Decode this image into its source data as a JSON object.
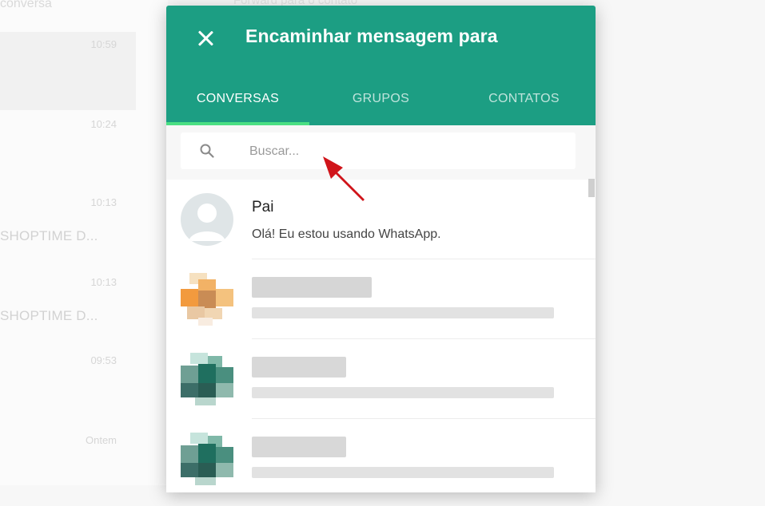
{
  "background": {
    "top_text": "conversa",
    "header_text": "Forward para o contato",
    "rows": [
      {
        "time": "10:59",
        "text": ""
      },
      {
        "time": "10:24",
        "text": ""
      },
      {
        "time": "10:13",
        "text": "SHOPTIME D..."
      },
      {
        "time": "10:13",
        "text": "SHOPTIME D..."
      },
      {
        "time": "09:53",
        "text": ""
      },
      {
        "time": "Ontem",
        "text": ""
      }
    ]
  },
  "modal": {
    "title": "Encaminhar mensagem para",
    "close_icon": "close-icon",
    "tabs": [
      {
        "label": "CONVERSAS",
        "active": true
      },
      {
        "label": "GRUPOS",
        "active": false
      },
      {
        "label": "CONTATOS",
        "active": false
      }
    ],
    "search": {
      "placeholder": "Buscar...",
      "value": ""
    },
    "contacts": [
      {
        "name": "Pai",
        "status": "Olá! Eu estou usando WhatsApp.",
        "blurred": false
      },
      {
        "name": "",
        "status": "",
        "blurred": true
      },
      {
        "name": "",
        "status": "",
        "blurred": true
      },
      {
        "name": "",
        "status": "",
        "blurred": true
      }
    ]
  },
  "colors": {
    "header": "#1c9e83",
    "tab_indicator": "#4adf83",
    "annotation_arrow": "#d0141a"
  }
}
